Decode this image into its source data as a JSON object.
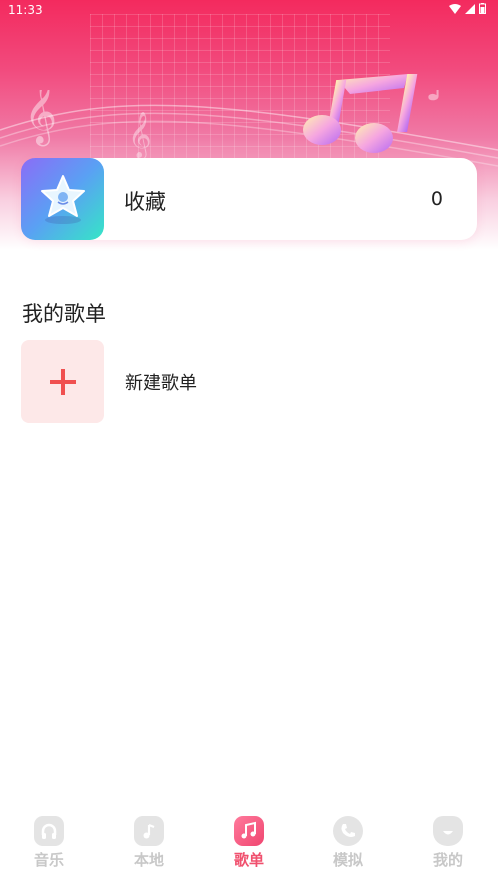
{
  "status_bar": {
    "time": "11:33"
  },
  "favorites": {
    "label": "收藏",
    "count": "0",
    "icon": "star-icon"
  },
  "playlists": {
    "section_title": "我的歌单",
    "new_label": "新建歌单",
    "new_icon": "plus-icon"
  },
  "tabs": [
    {
      "label": "音乐",
      "icon": "headphones-icon",
      "active": false
    },
    {
      "label": "本地",
      "icon": "folder-music-icon",
      "active": false
    },
    {
      "label": "歌单",
      "icon": "music-note-icon",
      "active": true
    },
    {
      "label": "模拟",
      "icon": "phone-icon",
      "active": false
    },
    {
      "label": "我的",
      "icon": "smile-icon",
      "active": false
    }
  ],
  "colors": {
    "accent": "#f0506e",
    "inactive": "#c8c8c8",
    "plus": "#f05050",
    "new_bg": "#fde8e8"
  }
}
